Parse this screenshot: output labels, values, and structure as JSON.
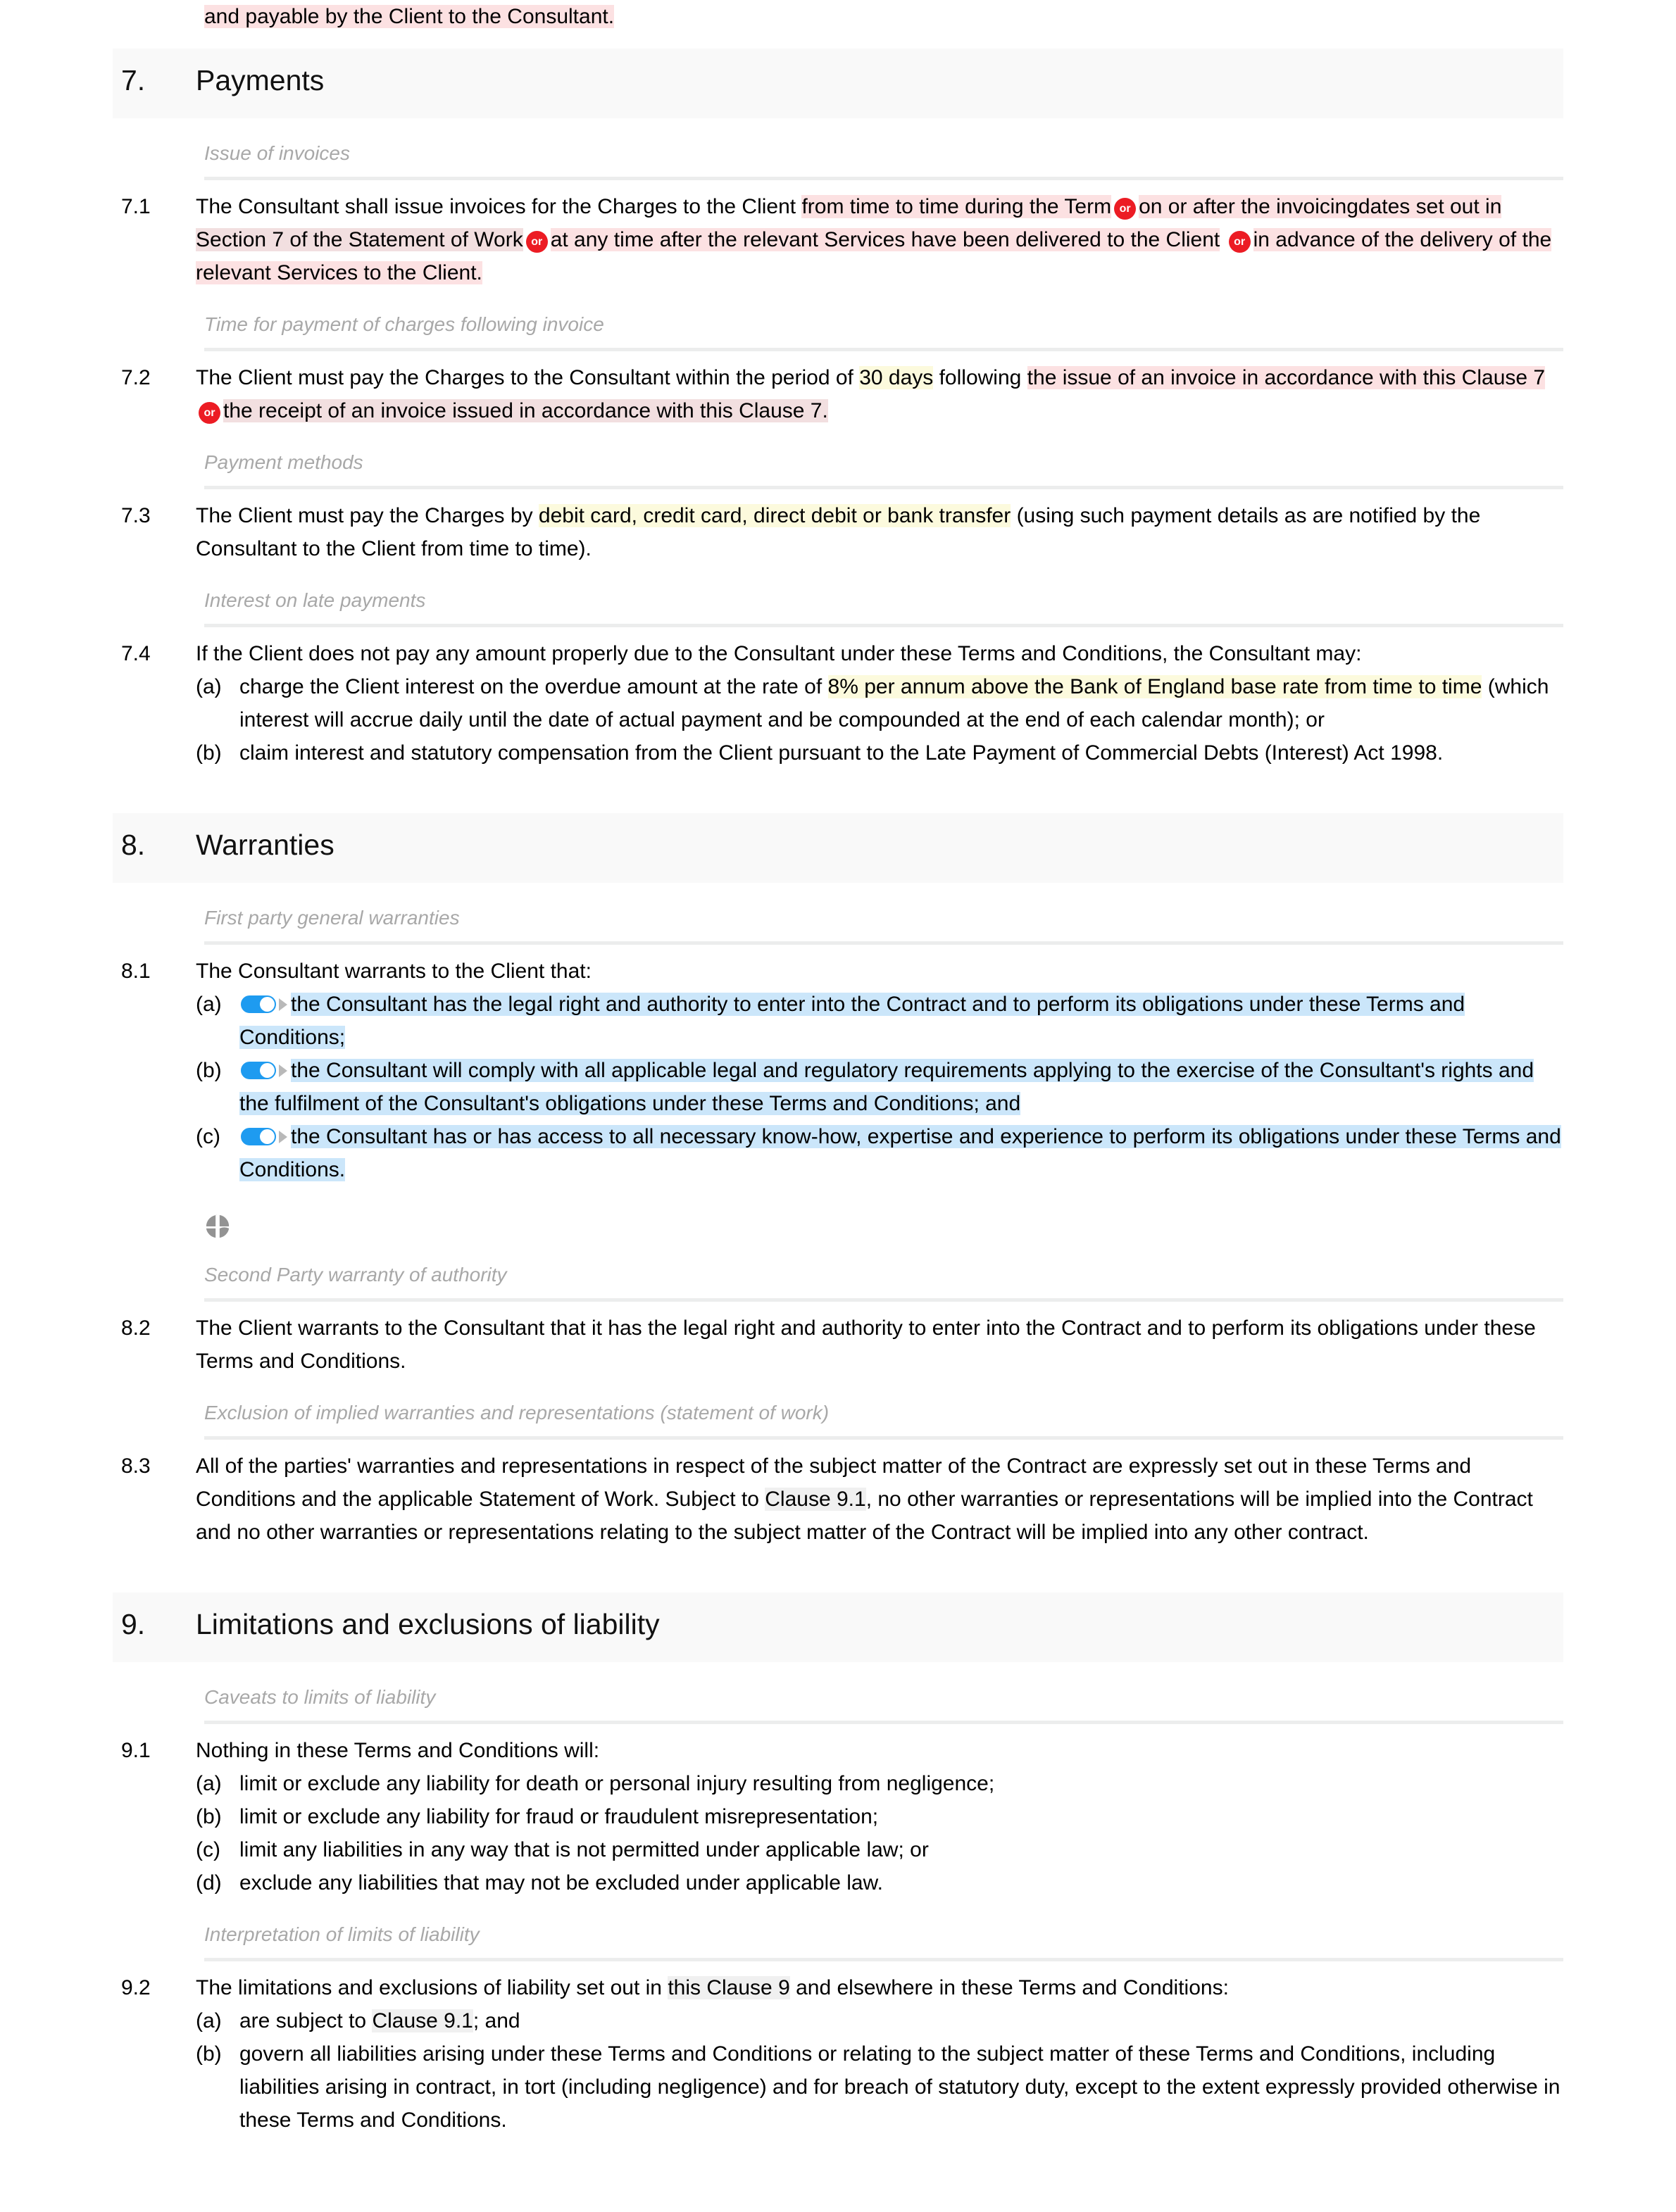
{
  "colors": {
    "highlight_pink": "#fce1e2",
    "highlight_pink_dark": "#f2dfe0",
    "highlight_yellow": "#fcfadd",
    "highlight_blue": "#cbe6fa",
    "highlight_grey": "#f0f0f0",
    "or_badge": "#ec1c24",
    "toggle_on": "#1e9bf0",
    "section_bar": "#f9f9f9",
    "subheading_text": "#a8a8a8"
  },
  "continued_line": {
    "text": "and payable by the Client to the Consultant."
  },
  "sections": [
    {
      "number": "7.",
      "title": "Payments",
      "groups": [
        {
          "subheading": "Issue of invoices",
          "clauses": [
            {
              "number": "7.1",
              "line1_a": "The Consultant shall issue invoices for the Charges to the Client ",
              "line1_b": "from time to time during the Term",
              "or1": "or",
              "line1_c": "on or after the invoicing",
              "line2_a": "dates set out in ",
              "line2_b": "Section 7 of the Statement of Work",
              "or2": "or",
              "line2_c": "at any time after the relevant Services have been delivered to the Client",
              "or3": "or",
              "line3": "in advance of the delivery of the relevant Services to the Client.",
              "dotted_terms": [
                "Charges",
                "Term",
                "Services"
              ]
            }
          ]
        },
        {
          "subheading": "Time for payment of charges following invoice",
          "clauses": [
            {
              "number": "7.2",
              "part_a": "The Client must pay the Charges to the Consultant within the period of ",
              "part_days": "30 days",
              "part_b": " following ",
              "part_c": "the issue of an invoice in accordance with this Clause 7",
              "or1": "or",
              "part_d": "the receipt of an invoice issued in accordance with this Clause 7."
            }
          ]
        },
        {
          "subheading": "Payment methods",
          "clauses": [
            {
              "number": "7.3",
              "part_a": "The Client must pay the Charges by ",
              "part_methods": "debit card, credit card, direct debit or bank transfer",
              "part_b": " (using such payment details as are notified by the Consultant to the Client from time to time)."
            }
          ]
        },
        {
          "subheading": "Interest on late payments",
          "clauses": [
            {
              "number": "7.4",
              "lead": "If the Client does not pay any amount properly due to the Consultant under these Terms and Conditions, the Consultant may:",
              "items": [
                {
                  "marker": "(a)",
                  "part_a": "charge the Client interest on the overdue amount at the rate of ",
                  "part_rate": "8% per annum above the Bank of England base rate from time to time",
                  "part_b": " (which interest will accrue daily until the date of actual payment and be compounded at the end of each calendar month); or"
                },
                {
                  "marker": "(b)",
                  "text": "claim interest and statutory compensation from the Client pursuant to the Late Payment of Commercial Debts (Interest) Act 1998."
                }
              ]
            }
          ]
        }
      ]
    },
    {
      "number": "8.",
      "title": "Warranties",
      "groups": [
        {
          "subheading": "First party general warranties",
          "clauses": [
            {
              "number": "8.1",
              "lead": "The Consultant warrants to the Client that:",
              "items": [
                {
                  "marker": "(a)",
                  "toggle": true,
                  "text": "the Consultant has the legal right and authority to enter into the Contract and to perform its obligations under these Terms and Conditions;"
                },
                {
                  "marker": "(b)",
                  "toggle": true,
                  "text": "the Consultant will comply with all applicable legal and regulatory requirements applying to the exercise of the Consultant's rights and the fulfilment of the Consultant's obligations under these Terms and Conditions; and"
                },
                {
                  "marker": "(c)",
                  "toggle": true,
                  "text": "the Consultant has or has access to all necessary know-how, expertise and experience to perform its obligations under these Terms and Conditions."
                }
              ],
              "quad_icon": "move-quadrant-icon"
            }
          ]
        },
        {
          "subheading": "Second Party warranty of authority",
          "clauses": [
            {
              "number": "8.2",
              "text": "The Client warrants to the Consultant that it has the legal right and authority to enter into the Contract and to perform its obligations under these Terms and Conditions."
            }
          ]
        },
        {
          "subheading": "Exclusion of implied warranties and representations (statement of work)",
          "clauses": [
            {
              "number": "8.3",
              "part_a": "All of the parties' warranties and representations in respect of the subject matter of the Contract are expressly set out in these Terms and Conditions and the applicable Statement of Work. Subject to ",
              "part_ref": "Clause 9.1",
              "part_b": ", no other warranties or representations will be implied into the Contract and no other warranties or representations relating to the subject matter of the Contract will be implied into any other contract."
            }
          ]
        }
      ]
    },
    {
      "number": "9.",
      "title": "Limitations and exclusions of liability",
      "groups": [
        {
          "subheading": "Caveats to limits of liability",
          "clauses": [
            {
              "number": "9.1",
              "lead": "Nothing in these Terms and Conditions will:",
              "items": [
                {
                  "marker": "(a)",
                  "text": "limit or exclude any liability for death or personal injury resulting from negligence;"
                },
                {
                  "marker": "(b)",
                  "text": "limit or exclude any liability for fraud or fraudulent misrepresentation;"
                },
                {
                  "marker": "(c)",
                  "text": "limit any liabilities in any way that is not permitted under applicable law; or"
                },
                {
                  "marker": "(d)",
                  "text": "exclude any liabilities that may not be excluded under applicable law."
                }
              ]
            }
          ]
        },
        {
          "subheading": "Interpretation of limits of liability",
          "clauses": [
            {
              "number": "9.2",
              "lead_a": "The limitations and exclusions of liability set out in ",
              "lead_ref": "this Clause 9",
              "lead_b": " and elsewhere in these Terms and Conditions:",
              "items": [
                {
                  "marker": "(a)",
                  "part_a": "are subject to ",
                  "part_ref": "Clause 9.1",
                  "part_b": "; and"
                },
                {
                  "marker": "(b)",
                  "text": "govern all liabilities arising under these Terms and Conditions or relating to the subject matter of these Terms and Conditions, including liabilities arising in contract, in tort (including negligence) and for breach of statutory duty, except to the extent expressly provided otherwise in these Terms and Conditions."
                }
              ]
            }
          ]
        }
      ]
    }
  ]
}
